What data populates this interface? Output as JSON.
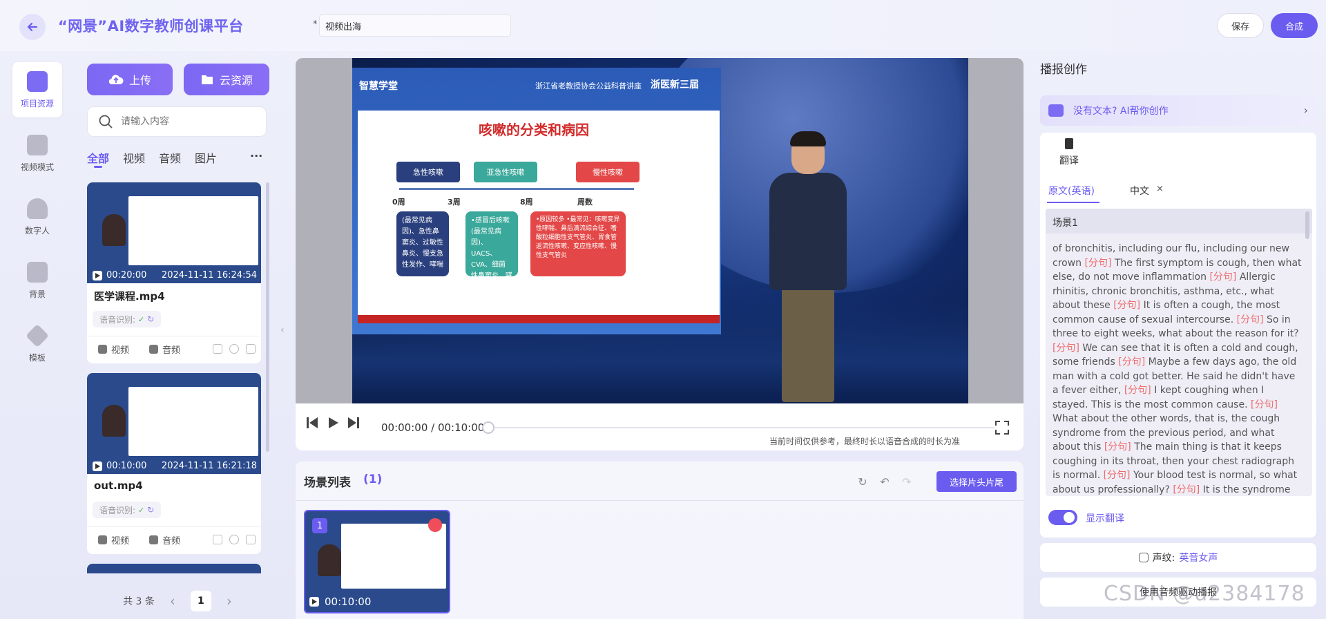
{
  "header": {
    "brand": "“网景”AI数字教师创课平台",
    "title_required_mark": "*",
    "title_value": "视频出海",
    "save_label": "保存",
    "compose_label": "合成"
  },
  "nav": {
    "items": [
      {
        "label": "项目资源",
        "icon": "folder-icon",
        "active": true
      },
      {
        "label": "视频模式",
        "icon": "video-camera-icon"
      },
      {
        "label": "数字人",
        "icon": "robot-icon"
      },
      {
        "label": "背景",
        "icon": "image-icon"
      },
      {
        "label": "模板",
        "icon": "cube-icon"
      }
    ]
  },
  "resources": {
    "upload_label": "上传",
    "cloud_label": "云资源",
    "search_placeholder": "请输入内容",
    "tabs": [
      "全部",
      "视频",
      "音频",
      "图片"
    ],
    "more_label": "···",
    "cards": [
      {
        "duration": "00:20:00",
        "date": "2024-11-11 16:24:54",
        "name": "医学课程.mp4",
        "asr_label": "语音识别:",
        "video_label": "视频",
        "audio_label": "音频"
      },
      {
        "duration": "00:10:00",
        "date": "2024-11-11 16:21:18",
        "name": "out.mp4",
        "asr_label": "语音识别:",
        "video_label": "视频",
        "audio_label": "音频"
      }
    ],
    "pager": {
      "total": "共 3 条",
      "prev": "‹",
      "page": "1",
      "next": "›"
    }
  },
  "preview": {
    "slide": {
      "header_left": "智慧学堂",
      "header_mid": "浙江省老教授协会公益科普讲座",
      "header_right": "浙医新三届",
      "title": "咳嗽的分类和病因",
      "pills": [
        "急性咳嗽",
        "亚急性咳嗽",
        "慢性咳嗽"
      ],
      "axis_labels": [
        "0周",
        "3周",
        "8周",
        "周数"
      ],
      "boxes": [
        "(最常见病因)、急性鼻窦炎、过敏性鼻炎、慢支急性发作、哮喘",
        "•感冒后咳嗽(最常见病因)、UACS、CVA、细菌性鼻窦炎、哮喘",
        "•原因较多 •最常见：咳嗽变异性哮喘、鼻后滴流综合征、嗜酸粒细胞性支气管炎、胃食管返流性咳嗽、变应性咳嗽、慢性支气管炎"
      ]
    },
    "time": "00:00:00 / 00:10:00",
    "progress": 0,
    "note": "当前时间仅供参考，最终时长以语音合成的时长为准"
  },
  "scenes": {
    "title": "场景列表",
    "count": "(1)",
    "pick_label": "选择片头片尾",
    "items": [
      {
        "num": "1",
        "duration": "00:10:00"
      }
    ]
  },
  "right": {
    "title": "播报创作",
    "ai_prompt": "没有文本? AI帮你创作",
    "translate_tab": "翻译",
    "tab_original": "原文(英语)",
    "tab_chinese": "中文",
    "tab_close": "×",
    "scene_label": "场景1",
    "script_segments": [
      "of bronchitis, including our flu, including our new crown",
      "The first symptom is cough, then what else, do not move inflammation",
      "Allergic rhinitis, chronic bronchitis, asthma, etc., what about these",
      "It is often a cough, the most common cause of sexual intercourse.",
      "So in three to eight weeks, what about the reason for it?",
      "We can see that it is often a cold and cough, some friends",
      "Maybe a few days ago, the old man with a cold got better. He said he didn't have a fever either,",
      "I kept coughing when I stayed. This is the most common cause.",
      "What about the other words, that is, the cough syndrome from the previous period, and what about this",
      "The main thing is that it keeps coughing in its throat, then your chest radiograph is normal.",
      "Your blood test is normal, so what about us professionally?",
      "It is the syndrome from the previous period to cough"
    ],
    "separator": "[分句]",
    "show_translation_label": "显示翻译",
    "show_translation": true,
    "voice_label": "声纹:",
    "voice_value": "英音女声",
    "audio_driver_label": "使用音频驱动播报"
  },
  "watermark": "CSDN @u2384178",
  "colors": {
    "accent": "#6b5cf0",
    "danger": "#ef4d5a",
    "separator": "#ee6b6b"
  }
}
